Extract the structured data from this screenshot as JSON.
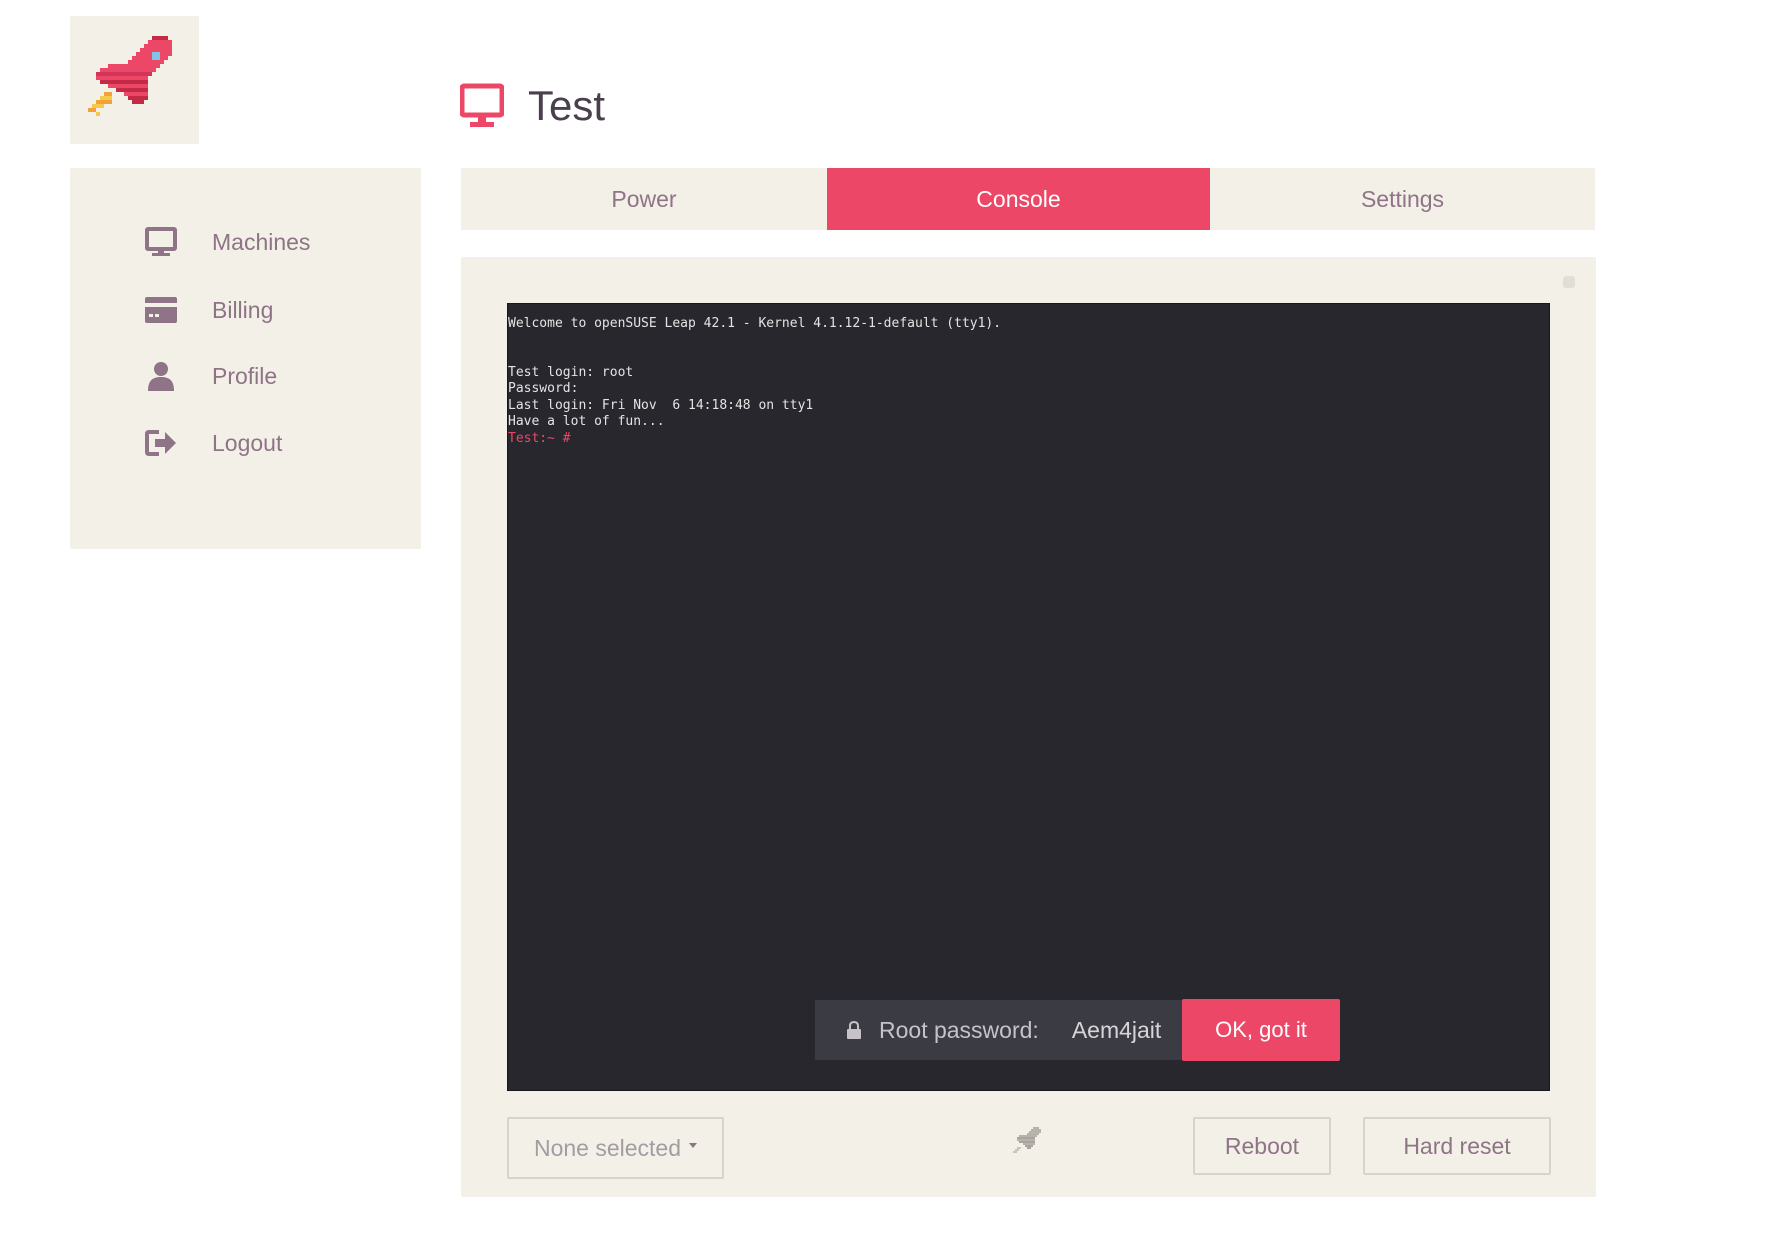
{
  "page": {
    "title": "Test",
    "title_icon": "monitor-icon"
  },
  "logo": {
    "icon": "rocket-logo"
  },
  "sidebar": {
    "items": [
      {
        "label": "Machines",
        "icon": "monitor-icon"
      },
      {
        "label": "Billing",
        "icon": "credit-card-icon"
      },
      {
        "label": "Profile",
        "icon": "user-icon"
      },
      {
        "label": "Logout",
        "icon": "logout-icon"
      }
    ]
  },
  "tabs": {
    "items": [
      {
        "label": "Power"
      },
      {
        "label": "Console",
        "active": true
      },
      {
        "label": "Settings"
      }
    ]
  },
  "console": {
    "lines": [
      "Welcome to openSUSE Leap 42.1 - Kernel 4.1.12-1-default (tty1).",
      "",
      "",
      "Test login: root",
      "Password:",
      "Last login: Fri Nov  6 14:18:48 on tty1",
      "Have a lot of fun..."
    ],
    "prompt": "Test:~ #",
    "password_notice": {
      "label": "Root password:",
      "value": "Aem4jait",
      "confirm_label": "OK, got it"
    }
  },
  "controls": {
    "select_placeholder": "None selected",
    "reboot_label": "Reboot",
    "hard_reset_label": "Hard reset"
  },
  "colors": {
    "accent": "#ec4766",
    "panel": "#f3f0e8",
    "terminal_bg": "#27272d",
    "muted_text": "#8e7486"
  }
}
